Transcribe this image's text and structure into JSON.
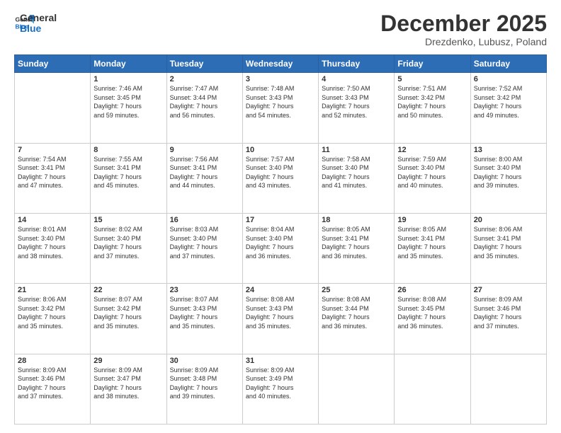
{
  "header": {
    "logo_general": "General",
    "logo_blue": "Blue",
    "month_title": "December 2025",
    "location": "Drezdenko, Lubusz, Poland"
  },
  "days_of_week": [
    "Sunday",
    "Monday",
    "Tuesday",
    "Wednesday",
    "Thursday",
    "Friday",
    "Saturday"
  ],
  "weeks": [
    [
      {
        "day": "",
        "sunrise": "",
        "sunset": "",
        "daylight": ""
      },
      {
        "day": "1",
        "sunrise": "Sunrise: 7:46 AM",
        "sunset": "Sunset: 3:45 PM",
        "daylight": "Daylight: 7 hours and 59 minutes."
      },
      {
        "day": "2",
        "sunrise": "Sunrise: 7:47 AM",
        "sunset": "Sunset: 3:44 PM",
        "daylight": "Daylight: 7 hours and 56 minutes."
      },
      {
        "day": "3",
        "sunrise": "Sunrise: 7:48 AM",
        "sunset": "Sunset: 3:43 PM",
        "daylight": "Daylight: 7 hours and 54 minutes."
      },
      {
        "day": "4",
        "sunrise": "Sunrise: 7:50 AM",
        "sunset": "Sunset: 3:43 PM",
        "daylight": "Daylight: 7 hours and 52 minutes."
      },
      {
        "day": "5",
        "sunrise": "Sunrise: 7:51 AM",
        "sunset": "Sunset: 3:42 PM",
        "daylight": "Daylight: 7 hours and 50 minutes."
      },
      {
        "day": "6",
        "sunrise": "Sunrise: 7:52 AM",
        "sunset": "Sunset: 3:42 PM",
        "daylight": "Daylight: 7 hours and 49 minutes."
      }
    ],
    [
      {
        "day": "7",
        "sunrise": "Sunrise: 7:54 AM",
        "sunset": "Sunset: 3:41 PM",
        "daylight": "Daylight: 7 hours and 47 minutes."
      },
      {
        "day": "8",
        "sunrise": "Sunrise: 7:55 AM",
        "sunset": "Sunset: 3:41 PM",
        "daylight": "Daylight: 7 hours and 45 minutes."
      },
      {
        "day": "9",
        "sunrise": "Sunrise: 7:56 AM",
        "sunset": "Sunset: 3:41 PM",
        "daylight": "Daylight: 7 hours and 44 minutes."
      },
      {
        "day": "10",
        "sunrise": "Sunrise: 7:57 AM",
        "sunset": "Sunset: 3:40 PM",
        "daylight": "Daylight: 7 hours and 43 minutes."
      },
      {
        "day": "11",
        "sunrise": "Sunrise: 7:58 AM",
        "sunset": "Sunset: 3:40 PM",
        "daylight": "Daylight: 7 hours and 41 minutes."
      },
      {
        "day": "12",
        "sunrise": "Sunrise: 7:59 AM",
        "sunset": "Sunset: 3:40 PM",
        "daylight": "Daylight: 7 hours and 40 minutes."
      },
      {
        "day": "13",
        "sunrise": "Sunrise: 8:00 AM",
        "sunset": "Sunset: 3:40 PM",
        "daylight": "Daylight: 7 hours and 39 minutes."
      }
    ],
    [
      {
        "day": "14",
        "sunrise": "Sunrise: 8:01 AM",
        "sunset": "Sunset: 3:40 PM",
        "daylight": "Daylight: 7 hours and 38 minutes."
      },
      {
        "day": "15",
        "sunrise": "Sunrise: 8:02 AM",
        "sunset": "Sunset: 3:40 PM",
        "daylight": "Daylight: 7 hours and 37 minutes."
      },
      {
        "day": "16",
        "sunrise": "Sunrise: 8:03 AM",
        "sunset": "Sunset: 3:40 PM",
        "daylight": "Daylight: 7 hours and 37 minutes."
      },
      {
        "day": "17",
        "sunrise": "Sunrise: 8:04 AM",
        "sunset": "Sunset: 3:40 PM",
        "daylight": "Daylight: 7 hours and 36 minutes."
      },
      {
        "day": "18",
        "sunrise": "Sunrise: 8:05 AM",
        "sunset": "Sunset: 3:41 PM",
        "daylight": "Daylight: 7 hours and 36 minutes."
      },
      {
        "day": "19",
        "sunrise": "Sunrise: 8:05 AM",
        "sunset": "Sunset: 3:41 PM",
        "daylight": "Daylight: 7 hours and 35 minutes."
      },
      {
        "day": "20",
        "sunrise": "Sunrise: 8:06 AM",
        "sunset": "Sunset: 3:41 PM",
        "daylight": "Daylight: 7 hours and 35 minutes."
      }
    ],
    [
      {
        "day": "21",
        "sunrise": "Sunrise: 8:06 AM",
        "sunset": "Sunset: 3:42 PM",
        "daylight": "Daylight: 7 hours and 35 minutes."
      },
      {
        "day": "22",
        "sunrise": "Sunrise: 8:07 AM",
        "sunset": "Sunset: 3:42 PM",
        "daylight": "Daylight: 7 hours and 35 minutes."
      },
      {
        "day": "23",
        "sunrise": "Sunrise: 8:07 AM",
        "sunset": "Sunset: 3:43 PM",
        "daylight": "Daylight: 7 hours and 35 minutes."
      },
      {
        "day": "24",
        "sunrise": "Sunrise: 8:08 AM",
        "sunset": "Sunset: 3:43 PM",
        "daylight": "Daylight: 7 hours and 35 minutes."
      },
      {
        "day": "25",
        "sunrise": "Sunrise: 8:08 AM",
        "sunset": "Sunset: 3:44 PM",
        "daylight": "Daylight: 7 hours and 36 minutes."
      },
      {
        "day": "26",
        "sunrise": "Sunrise: 8:08 AM",
        "sunset": "Sunset: 3:45 PM",
        "daylight": "Daylight: 7 hours and 36 minutes."
      },
      {
        "day": "27",
        "sunrise": "Sunrise: 8:09 AM",
        "sunset": "Sunset: 3:46 PM",
        "daylight": "Daylight: 7 hours and 37 minutes."
      }
    ],
    [
      {
        "day": "28",
        "sunrise": "Sunrise: 8:09 AM",
        "sunset": "Sunset: 3:46 PM",
        "daylight": "Daylight: 7 hours and 37 minutes."
      },
      {
        "day": "29",
        "sunrise": "Sunrise: 8:09 AM",
        "sunset": "Sunset: 3:47 PM",
        "daylight": "Daylight: 7 hours and 38 minutes."
      },
      {
        "day": "30",
        "sunrise": "Sunrise: 8:09 AM",
        "sunset": "Sunset: 3:48 PM",
        "daylight": "Daylight: 7 hours and 39 minutes."
      },
      {
        "day": "31",
        "sunrise": "Sunrise: 8:09 AM",
        "sunset": "Sunset: 3:49 PM",
        "daylight": "Daylight: 7 hours and 40 minutes."
      },
      {
        "day": "",
        "sunrise": "",
        "sunset": "",
        "daylight": ""
      },
      {
        "day": "",
        "sunrise": "",
        "sunset": "",
        "daylight": ""
      },
      {
        "day": "",
        "sunrise": "",
        "sunset": "",
        "daylight": ""
      }
    ]
  ]
}
